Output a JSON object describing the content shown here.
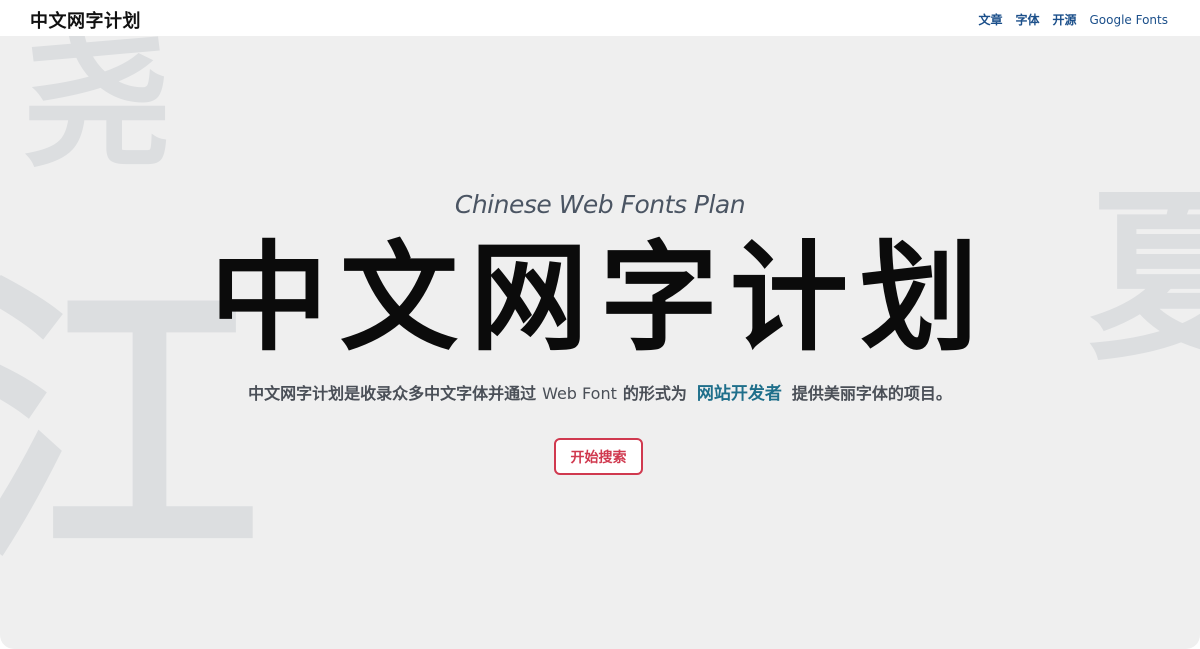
{
  "header": {
    "brand": "中文网字计划",
    "nav": [
      {
        "label": "文章"
      },
      {
        "label": "字体"
      },
      {
        "label": "开源"
      },
      {
        "label": "Google Fonts"
      }
    ]
  },
  "hero": {
    "background_chars": {
      "top_left": "尧",
      "left": "江",
      "right": "夏"
    },
    "subtitle": "Chinese Web Fonts Plan",
    "headline": "中文网字计划",
    "description": {
      "part1": "中文网字计划是收录众多中文字体并通过",
      "web_font": "Web Font",
      "part2": "的形式为",
      "highlight": "网站开发者",
      "part3": "提供美丽字体的项目。"
    },
    "cta_label": "开始搜索"
  },
  "colors": {
    "nav_link": "#1b4f8a",
    "highlight": "#1f6f8b",
    "cta": "#d0394f",
    "hero_bg": "#efefef"
  }
}
